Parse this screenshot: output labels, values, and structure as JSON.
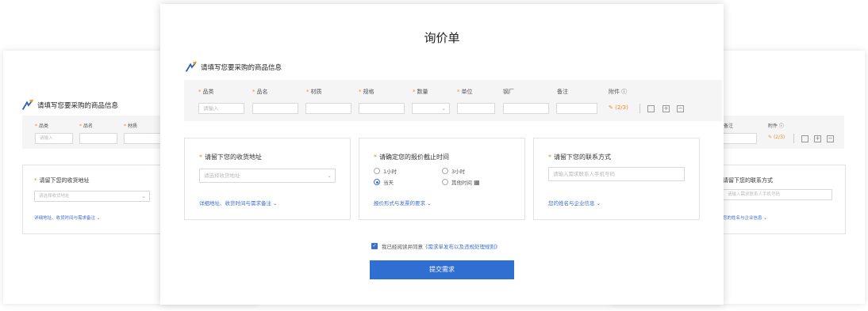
{
  "page_title": "询价单",
  "product_section": {
    "heading": "请填写您要采购的商品信息",
    "columns": [
      {
        "label": "品类",
        "required": true
      },
      {
        "label": "品名",
        "required": true
      },
      {
        "label": "材质",
        "required": true
      },
      {
        "label": "规格",
        "required": true
      },
      {
        "label": "数量",
        "required": true
      },
      {
        "label": "单位",
        "required": true
      },
      {
        "label": "钢厂",
        "required": false
      },
      {
        "label": "备注",
        "required": false
      },
      {
        "label": "附件",
        "required": false
      }
    ],
    "category_placeholder": "请输入",
    "attachment_count": "(2/3)"
  },
  "address_panel": {
    "title": "请留下您的收货地址",
    "select_placeholder": "请选择收货地址",
    "expand_link": "详细地址、收货时间与需求备注"
  },
  "deadline_panel": {
    "title": "请确定您的报价截止时间",
    "options": [
      "1小时",
      "3小时",
      "当天",
      "其他时间"
    ],
    "selected": "当天",
    "expand_link": "报价形式与发票的要求"
  },
  "contact_panel": {
    "title": "请留下您的联系方式",
    "phone_placeholder": "请输入需求联系人手机号码",
    "expand_link": "您的姓名与企业信息"
  },
  "agreement": {
    "text": "我已经阅读并同意",
    "link": "《需求单发布以及违规处理规则》",
    "checked": true
  },
  "submit_label": "提交需求",
  "colors": {
    "accent": "#2f6fd1",
    "required": "#f08a24",
    "link": "#3b6fcf"
  }
}
